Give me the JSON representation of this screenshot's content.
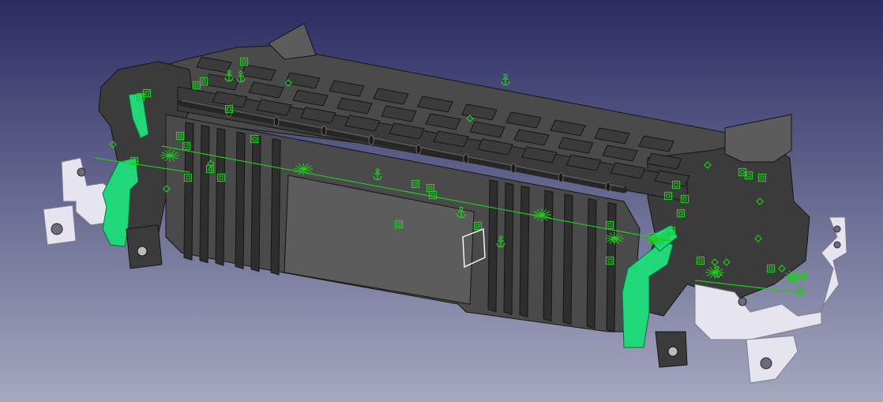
{
  "viewport": {
    "background_top": "#2a2c62",
    "background_bottom": "#a6a8c0"
  },
  "model": {
    "body_dark": "#3b3b3b",
    "body_mid": "#4a4a4a",
    "body_light": "#5c5c5c",
    "edge": "#151515",
    "rib": "#2e2e2e",
    "roller": "#262626",
    "bracket": "#e6e4ee",
    "bracket_edge": "#7d7b90",
    "lever": "#20d77a",
    "lever_edge": "#0a6f3a",
    "constraint": "#1ecc1e",
    "selection": "#ffffff"
  },
  "icons": {
    "constraint": "square-in-square",
    "anchor": "anchor",
    "tangency": "diamond"
  }
}
